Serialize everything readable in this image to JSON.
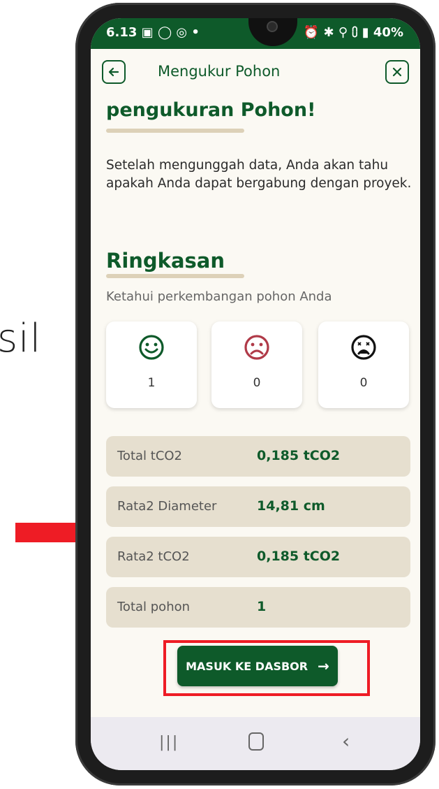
{
  "side_text": "sil",
  "status": {
    "time": "6.13 ▣ ◯ ◎ •",
    "battery": "40%",
    "right_icons": "⏰ ✱ ⚲ ⩇ ▮ 40%"
  },
  "topbar": {
    "title": "Mengukur Pohon"
  },
  "headline": "pengukuran Pohon!",
  "description": "Setelah mengunggah data, Anda akan tahu apakah Anda dapat bergabung dengan proyek.",
  "summary": {
    "title": "Ringkasan",
    "subtitle": "Ketahui perkembangan pohon Anda",
    "cards": [
      {
        "icon": "happy-face-icon",
        "count": "1",
        "color": "#0e5a2a"
      },
      {
        "icon": "sad-face-icon",
        "count": "0",
        "color": "#b03a48"
      },
      {
        "icon": "dead-face-icon",
        "count": "0",
        "color": "#111111"
      }
    ]
  },
  "stats": [
    {
      "label": "Total tCO2",
      "value": "0,185 tCO2"
    },
    {
      "label": "Rata2 Diameter",
      "value": "14,81 cm"
    },
    {
      "label": "Rata2 tCO2",
      "value": "0,185 tCO2"
    },
    {
      "label": "Total pohon",
      "value": "1"
    }
  ],
  "cta": {
    "label": "MASUK KE DASBOR",
    "arrow": "→"
  },
  "colors": {
    "primary": "#0e5a2a",
    "accent_red": "#ee1c25",
    "stat_bg": "#e6dfcf"
  }
}
